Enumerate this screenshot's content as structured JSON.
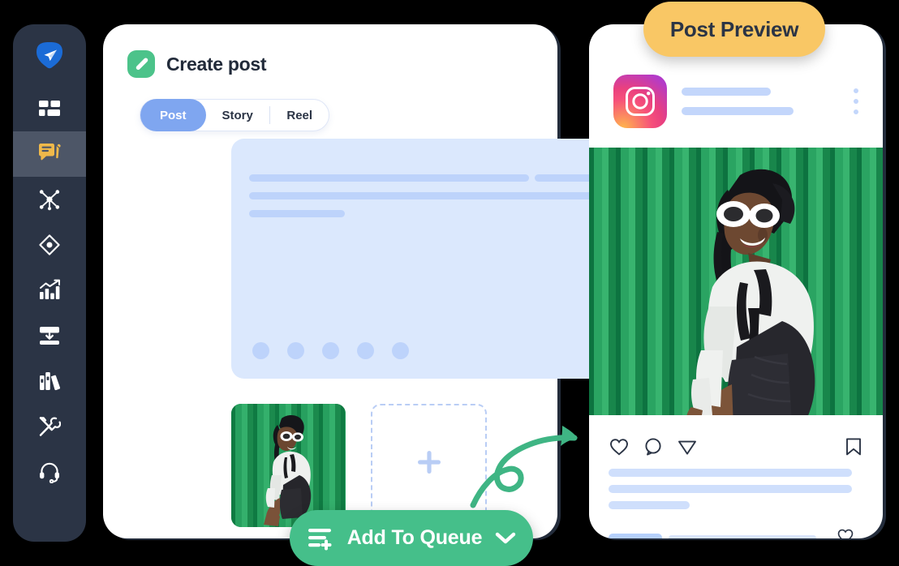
{
  "app": {
    "background_color": "#000000",
    "accent_green": "#45bf8a",
    "accent_blue": "#7fa6f0",
    "badge_yellow": "#f9c765",
    "sidebar_bg": "#2b3445"
  },
  "sidebar": {
    "logo": {
      "name": "app-logo-icon",
      "color": "#1b6bd6"
    },
    "items": [
      {
        "icon": "dashboard-grid-icon",
        "label": "Dashboard",
        "active": false
      },
      {
        "icon": "create-post-chat-icon",
        "label": "Create post",
        "active": true
      },
      {
        "icon": "network-share-icon",
        "label": "Connections",
        "active": false
      },
      {
        "icon": "compass-navigate-icon",
        "label": "Discover",
        "active": false
      },
      {
        "icon": "analytics-bar-chart-icon",
        "label": "Analytics",
        "active": false
      },
      {
        "icon": "inbox-download-icon",
        "label": "Inbox",
        "active": false
      },
      {
        "icon": "library-books-icon",
        "label": "Library",
        "active": false
      },
      {
        "icon": "tools-wrench-icon",
        "label": "Tools",
        "active": false
      },
      {
        "icon": "support-headset-icon",
        "label": "Support",
        "active": false
      }
    ]
  },
  "composer": {
    "icon": "pencil-edit-icon",
    "title": "Create post",
    "tabs": [
      {
        "label": "Post",
        "active": true
      },
      {
        "label": "Story",
        "active": false
      },
      {
        "label": "Reel",
        "active": false
      }
    ],
    "editor": {
      "placeholder_lines": 3,
      "toolbar_dots": 5
    },
    "media": {
      "thumbnail_alt": "Woman in white top and dark skirt against green striped wall",
      "add_media_icon": "plus-icon"
    },
    "primary_action": {
      "icon": "queue-add-icon",
      "label": "Add To Queue",
      "chevron": "chevron-down-icon",
      "color": "#45bf8a"
    }
  },
  "preview": {
    "badge": {
      "label": "Post Preview",
      "color": "#f9c765"
    },
    "network_icon": "instagram-icon",
    "menu_icon": "more-vertical-icon",
    "photo_alt": "Woman in white top and dark skirt against green striped wall",
    "actions": [
      {
        "icon": "heart-icon",
        "label": "Like"
      },
      {
        "icon": "comment-icon",
        "label": "Comment"
      },
      {
        "icon": "share-paper-plane-icon",
        "label": "Share"
      },
      {
        "icon": "bookmark-icon",
        "label": "Save"
      }
    ],
    "comment_like_icon": "heart-icon",
    "caption_lines": 3
  },
  "annotation": {
    "arrow_icon": "curved-arrow-icon",
    "color": "#45bf8a"
  }
}
